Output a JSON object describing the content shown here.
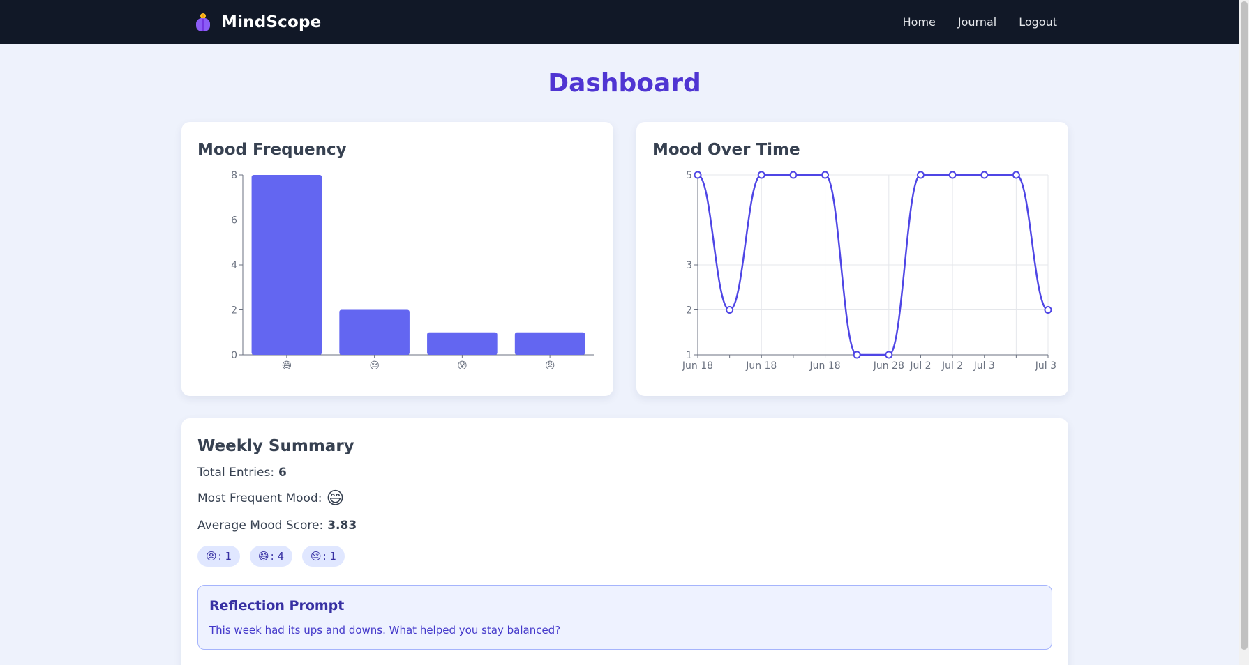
{
  "nav": {
    "brand": "MindScope",
    "links": [
      "Home",
      "Journal",
      "Logout"
    ]
  },
  "page": {
    "title": "Dashboard"
  },
  "colors": {
    "accent": "#6366f1",
    "line": "#4f46e5",
    "header_bg": "#111827"
  },
  "charts": {
    "frequency_title": "Mood Frequency",
    "over_time_title": "Mood Over Time"
  },
  "chart_data": [
    {
      "type": "bar",
      "title": "Mood Frequency",
      "categories": [
        "😄",
        "😔",
        "😰",
        "😠"
      ],
      "values": [
        8,
        2,
        1,
        1
      ],
      "ylim": [
        0,
        8
      ],
      "yticks": [
        0,
        2,
        4,
        6,
        8
      ],
      "grid": false
    },
    {
      "type": "line",
      "title": "Mood Over Time",
      "x": [
        "Jun 18",
        "",
        "Jun 18",
        "",
        "Jun 18",
        "",
        "Jun 28",
        "Jul 2",
        "Jul 2",
        "Jul 3",
        "",
        "Jul 3"
      ],
      "values": [
        5,
        2,
        5,
        5,
        5,
        1,
        1,
        5,
        5,
        5,
        5,
        2
      ],
      "ylim": [
        1,
        5
      ],
      "yticks": [
        1,
        2,
        3,
        5
      ],
      "grid": true
    }
  ],
  "summary": {
    "title": "Weekly Summary",
    "total_label": "Total Entries:",
    "total_value": "6",
    "frequent_label": "Most Frequent Mood:",
    "frequent_emoji": "😄",
    "average_label": "Average Mood Score:",
    "average_value": "3.83",
    "chips": [
      {
        "emoji": "😠",
        "count": ": 1"
      },
      {
        "emoji": "😄",
        "count": ": 4"
      },
      {
        "emoji": "😔",
        "count": ": 1"
      }
    ]
  },
  "reflection": {
    "title": "Reflection Prompt",
    "text": "This week had its ups and downs. What helped you stay balanced?"
  }
}
